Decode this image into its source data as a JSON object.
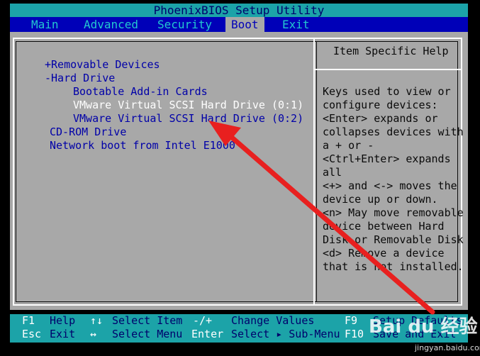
{
  "title": "PhoenixBIOS Setup Utility",
  "menu": [
    "Main",
    "Advanced",
    "Security",
    "Boot",
    "Exit"
  ],
  "active_menu": "Boot",
  "boot_items": [
    "+Removable Devices",
    "-Hard Drive",
    "Bootable Add-in Cards",
    "VMware Virtual SCSI Hard Drive (0:1)",
    "VMware Virtual SCSI Hard Drive (0:2)",
    "CD-ROM Drive",
    "Network boot from Intel E1000"
  ],
  "help": {
    "title": "Item Specific Help",
    "lines": [
      "Keys used to view or",
      "configure devices:",
      "<Enter> expands or",
      "collapses devices with",
      "a + or -",
      "<Ctrl+Enter> expands",
      "all",
      "<+> and <-> moves the",
      "device up or down.",
      "<n> May move removable",
      "device between Hard",
      "Disk or Removable Disk",
      "<d> Remove a device",
      "that is not installed."
    ]
  },
  "footer": {
    "row1": [
      {
        "key": "F1",
        "desc": "Help"
      },
      {
        "key": "↑↓",
        "desc": "Select Item"
      },
      {
        "key": "-/+",
        "desc": "Change Values"
      },
      {
        "key": "F9",
        "desc": "Setup Defaults"
      }
    ],
    "row2": [
      {
        "key": "Esc",
        "desc": "Exit"
      },
      {
        "key": "↔",
        "desc": "Select Menu"
      },
      {
        "key": "Enter",
        "desc": "Select ▸ Sub-Menu"
      },
      {
        "key": "F10",
        "desc": "Save and Exit"
      }
    ]
  },
  "watermark": {
    "logo": "Bai du 经验",
    "url": "jingyan.baidu.com"
  },
  "colors": {
    "title_bg": "#1ca3a8",
    "menu_bg": "#0000b8",
    "panel_bg": "#a8a8a8",
    "item_text": "#0000a8",
    "annotation_arrow": "#e8201f"
  }
}
